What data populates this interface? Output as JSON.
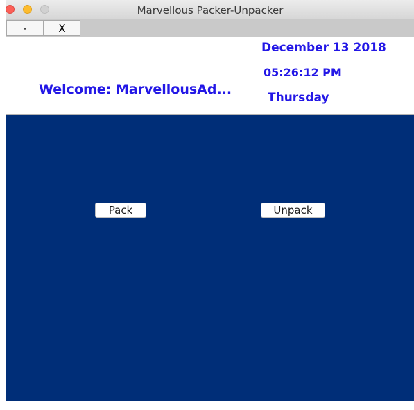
{
  "window": {
    "title": "Marvellous Packer-Unpacker"
  },
  "toolbar": {
    "minimize_label": "-",
    "close_label": "X"
  },
  "header": {
    "welcome": "Welcome: MarvellousAd...",
    "date": "December 13 2018",
    "time": "05:26:12 PM",
    "day": "Thursday",
    "text_color": "#2317e6"
  },
  "main": {
    "background_color": "#002e78",
    "pack_label": "Pack",
    "unpack_label": "Unpack"
  }
}
